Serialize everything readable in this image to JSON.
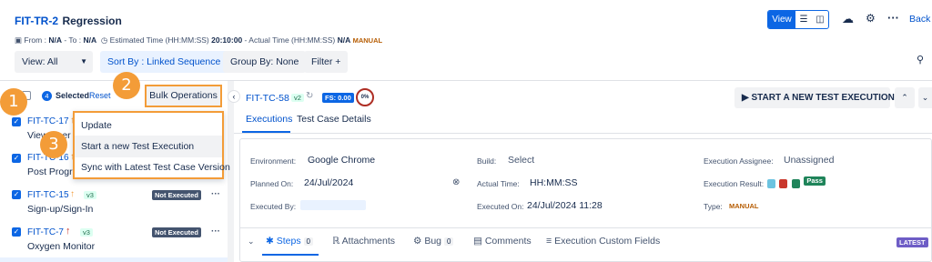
{
  "header": {
    "key": "FIT-TR-2",
    "name": "Regression",
    "from_label": "From :",
    "from_value": "N/A",
    "to_label": "- To :",
    "to_value": "N/A",
    "est_label": "Estimated Time (HH:MM:SS)",
    "est_value": "20:10:00",
    "actual_label": "- Actual Time (HH:MM:SS)",
    "actual_value": "N/A",
    "type_tag": "MANUAL",
    "view_label": "View",
    "back_label": "Back"
  },
  "filters": {
    "view": "View: All",
    "sort": "Sort By : Linked Sequence",
    "group": "Group By: None",
    "filter": "Filter +"
  },
  "selection": {
    "count": "4",
    "selected_label": "Selected",
    "reset_label": "Reset",
    "bulk_label": "Bulk Operations"
  },
  "callouts": [
    "1",
    "2",
    "3"
  ],
  "menu": {
    "items": [
      "Update",
      "Start a new Test Execution",
      "Sync with Latest Test Case Version"
    ]
  },
  "test_cases": [
    {
      "key": "FIT-TC-17",
      "name": "View User S",
      "version": "",
      "status": ""
    },
    {
      "key": "FIT-TC-16",
      "name": "Post Progra",
      "version": "",
      "status": ""
    },
    {
      "key": "FIT-TC-15",
      "name": "Sign-up/Sign-In",
      "version": "v3",
      "status": "Not Executed"
    },
    {
      "key": "FIT-TC-7",
      "name": "Oxygen Monitor",
      "version": "v3",
      "status": "Not Executed"
    }
  ],
  "detail": {
    "key": "FIT-TC-58",
    "version": "v2",
    "fs_label": "FS: 0.00",
    "progress": "0%",
    "start_button": "START A NEW TEST EXECUTION",
    "tabs": [
      "Executions",
      "Test Case Details"
    ],
    "fields": {
      "environment_label": "Environment:",
      "environment_value": "Google Chrome",
      "build_label": "Build:",
      "build_value": "Select",
      "assignee_label": "Execution Assignee:",
      "assignee_value": "Unassigned",
      "planned_label": "Planned On:",
      "planned_value": "24/Jul/2024",
      "actual_label": "Actual Time:",
      "actual_value": "HH:MM:SS",
      "result_label": "Execution Result:",
      "result_value": "Pass",
      "executed_by_label": "Executed By:",
      "executed_on_label": "Executed On:",
      "executed_on_value": "24/Jul/2024 11:28",
      "type_label": "Type:",
      "type_value": "MANUAL"
    },
    "bottom_tabs": {
      "steps": "Steps",
      "steps_count": "0",
      "attachments": "Attachments",
      "bug": "Bug",
      "bug_count": "0",
      "comments": "Comments",
      "custom_fields": "Execution Custom Fields",
      "latest": "LATEST"
    }
  },
  "colors": {
    "accent": "#0c66e4",
    "callout": "#f39c38",
    "manual": "#b65c02",
    "not_executed": "#44546f"
  }
}
